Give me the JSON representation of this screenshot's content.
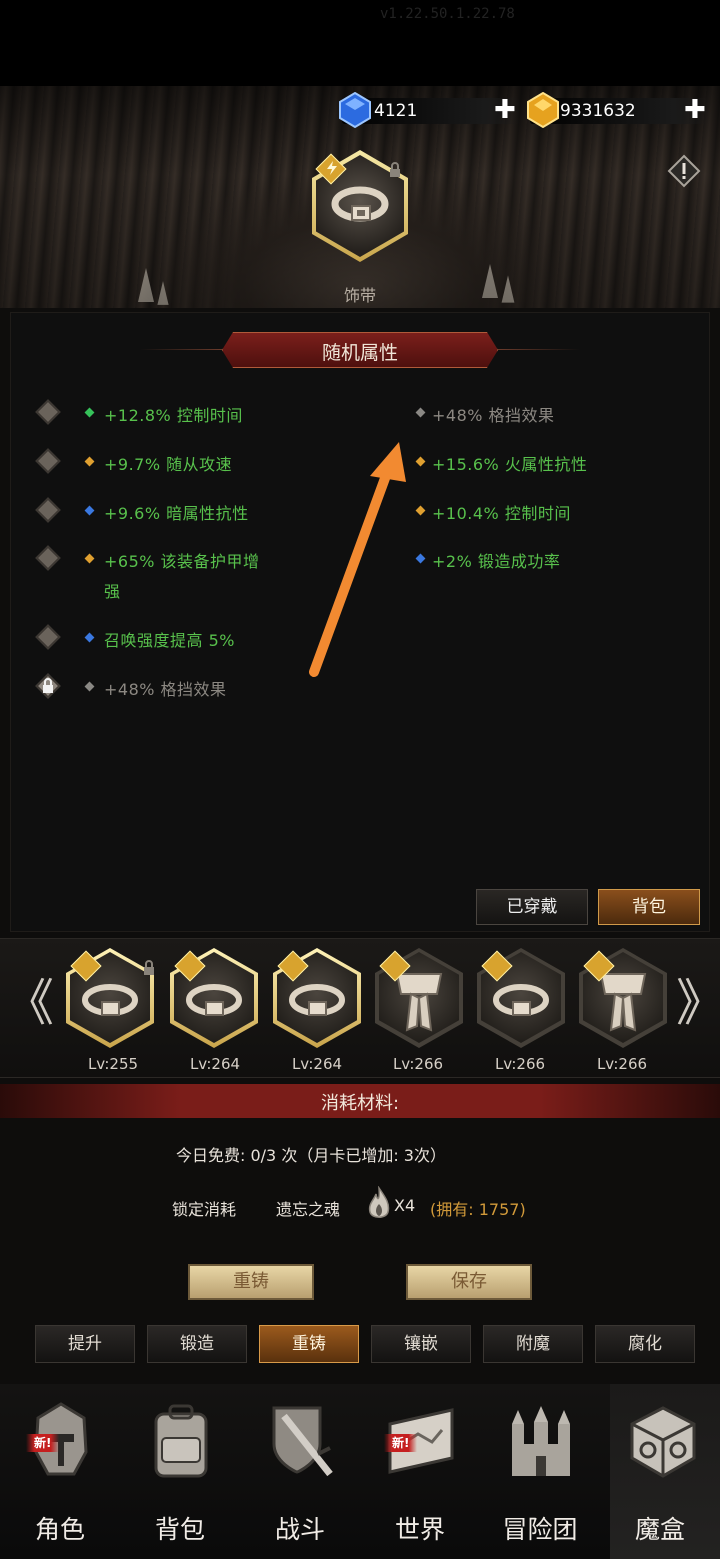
{
  "top": {
    "version": "v1.22.50.1.22.78"
  },
  "currency": {
    "gems": "4121",
    "gold": "9331632",
    "plus": "✚"
  },
  "item": {
    "name": "饰带"
  },
  "section": {
    "title": "随机属性"
  },
  "stats_left": [
    {
      "text": "+12.8% 控制时间",
      "gem": "#36c25a"
    },
    {
      "text": "+9.7% 随从攻速",
      "gem": "#e0a030"
    },
    {
      "text": "+9.6% 暗属性抗性",
      "gem": "#3a78e0"
    },
    {
      "text": "+65% 该装备护甲增",
      "text2": "强",
      "gem": "#e0a030"
    },
    {
      "text": "召唤强度提高 5%",
      "gem": "#3a78e0"
    },
    {
      "text": "+48% 格挡效果",
      "gem": "#8a8884"
    }
  ],
  "stats_right": [
    {
      "text": "+48% 格挡效果",
      "gem": "#8a8884"
    },
    {
      "text": "+15.6% 火属性抗性",
      "gem": "#e0a030"
    },
    {
      "text": "+10.4% 控制时间",
      "gem": "#e0a030"
    },
    {
      "text": "+2% 锻造成功率",
      "gem": "#3a78e0"
    }
  ],
  "panel_tabs": {
    "equipped": "已穿戴",
    "bag": "背包"
  },
  "equip_row": {
    "prev": "《",
    "next": "》",
    "items": [
      {
        "lv": "Lv:255",
        "type": "belt",
        "frame": "gold",
        "locked": true
      },
      {
        "lv": "Lv:264",
        "type": "belt",
        "frame": "gold",
        "locked": false
      },
      {
        "lv": "Lv:264",
        "type": "belt",
        "frame": "gold",
        "locked": false
      },
      {
        "lv": "Lv:266",
        "type": "sash",
        "frame": "plain",
        "locked": false
      },
      {
        "lv": "Lv:266",
        "type": "belt",
        "frame": "plain",
        "locked": false
      },
      {
        "lv": "Lv:266",
        "type": "sash",
        "frame": "plain",
        "locked": false
      }
    ]
  },
  "materials": {
    "title": "消耗材料:",
    "free_today": "今日免费: 0/3 次（月卡已增加: 3次）",
    "lock_cost_label": "锁定消耗",
    "lock_item": "遗忘之魂",
    "lock_qty": "X4",
    "owned": "(拥有: 1757)"
  },
  "actions": {
    "reforge": "重铸",
    "save": "保存"
  },
  "sub_tabs": [
    "提升",
    "锻造",
    "重铸",
    "镶嵌",
    "附魔",
    "腐化"
  ],
  "sub_tab_active": 2,
  "nav": {
    "items": [
      {
        "label": "角色",
        "icon": "helmet-icon",
        "new": true
      },
      {
        "label": "背包",
        "icon": "backpack-icon",
        "new": false
      },
      {
        "label": "战斗",
        "icon": "sword-shield-icon",
        "new": false
      },
      {
        "label": "世界",
        "icon": "scroll-map-icon",
        "new": true
      },
      {
        "label": "冒险团",
        "icon": "castle-icon",
        "new": false
      },
      {
        "label": "魔盒",
        "icon": "magic-cube-icon",
        "new": false
      }
    ],
    "new_text": "新!",
    "active_index": 5
  },
  "colors": {
    "accent_orange": "#f28a31",
    "stat_green": "#58c14c",
    "stat_gray": "#8c8882",
    "banner_red": "#7a1d19",
    "owned_orange": "#d29a3a"
  }
}
